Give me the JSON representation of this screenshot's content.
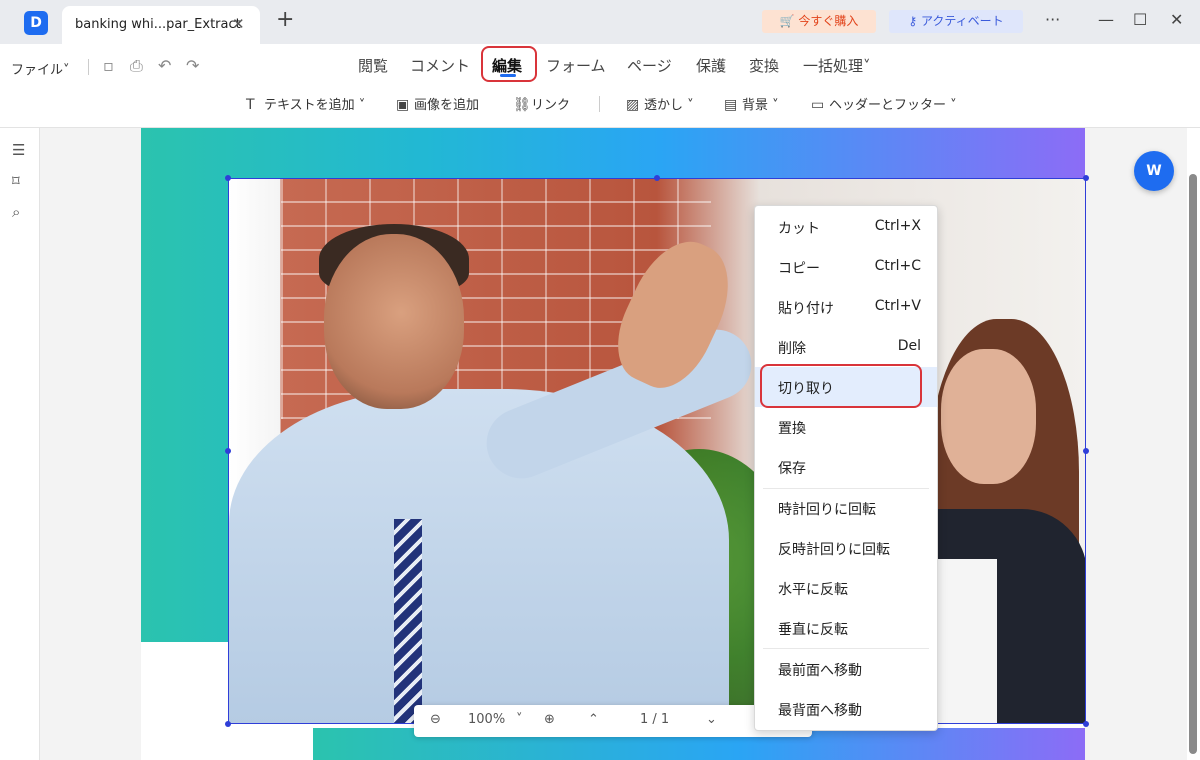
{
  "titlebar": {
    "app_icon": "pdf-app-icon",
    "tab_title": "banking whi...par_Extract",
    "close_glyph": "✕",
    "new_tab_glyph": "+",
    "buy_label": "🛒 今すぐ購入",
    "activate_label": "⚷ アクティベート",
    "more_glyph": "···",
    "min_glyph": "—",
    "max_glyph": "☐",
    "close_window_glyph": "✕"
  },
  "menubar": {
    "file_label": "ファイル˅",
    "tabs": [
      "閲覧",
      "コメント",
      "編集",
      "フォーム",
      "ページ",
      "保護",
      "変換",
      "一括処理˅"
    ],
    "active_tab": "編集",
    "subtools": {
      "add_text": "テキストを追加",
      "add_image": "画像を追加",
      "link": "リンク",
      "watermark": "透かし",
      "background": "背景",
      "header_footer": "ヘッダーとフッター"
    },
    "chevron": "˅"
  },
  "context_menu": {
    "items": [
      {
        "label": "カット",
        "shortcut": "Ctrl+X"
      },
      {
        "label": "コピー",
        "shortcut": "Ctrl+C"
      },
      {
        "label": "貼り付け",
        "shortcut": "Ctrl+V"
      },
      {
        "label": "削除",
        "shortcut": "Del"
      },
      {
        "label": "切り取り",
        "shortcut": ""
      },
      {
        "label": "置換",
        "shortcut": ""
      },
      {
        "label": "保存",
        "shortcut": ""
      },
      {
        "label": "時計回りに回転",
        "shortcut": ""
      },
      {
        "label": "反時計回りに回転",
        "shortcut": ""
      },
      {
        "label": "水平に反転",
        "shortcut": ""
      },
      {
        "label": "垂直に反転",
        "shortcut": ""
      },
      {
        "label": "最前面へ移動",
        "shortcut": ""
      },
      {
        "label": "最背面へ移動",
        "shortcut": ""
      }
    ],
    "highlighted": "切り取り"
  },
  "zoombar": {
    "zoom_out": "⊖",
    "zoom_value": "100%",
    "zoom_caret": "˅",
    "zoom_in": "⊕",
    "prev_page": "⌃",
    "page_indicator": "1 / 1",
    "next_page": "⌄"
  },
  "right_fab": "W",
  "colors": {
    "accent": "#1e6cf0",
    "highlight_red": "#d9343a",
    "selection_blue": "#2f3ed8",
    "banner_start": "#2bc3ae",
    "banner_end": "#8c6cf6"
  }
}
